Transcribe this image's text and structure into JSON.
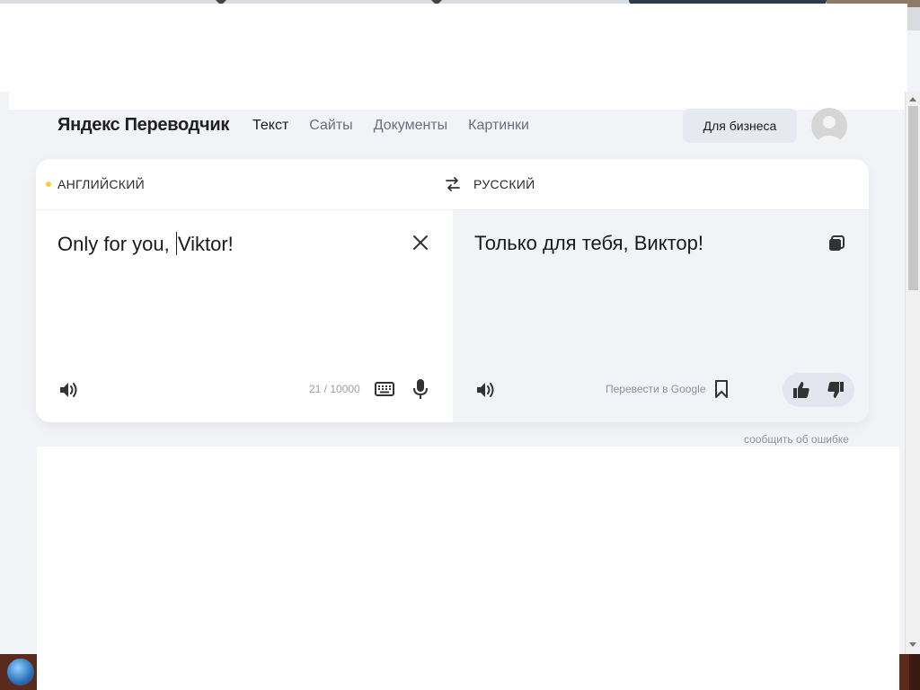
{
  "header": {
    "logo": "Яндекс Переводчик",
    "nav": [
      "Текст",
      "Сайты",
      "Документы",
      "Картинки"
    ],
    "business_button": "Для бизнеса"
  },
  "translator": {
    "source_language": "АНГЛИЙСКИЙ",
    "target_language": "РУССКИЙ",
    "source_text_before_caret": "Only for you, ",
    "source_text_after_caret": "Viktor!",
    "translated_text": "Только для тебя, Виктор!",
    "char_counter": "21 / 10000",
    "google_link": "Перевести в Google",
    "report_link": "сообщить об ошибке"
  },
  "colors": {
    "background": "#f2f3f7",
    "source_dot": "#ffcc33",
    "panel": "#ffffff"
  },
  "icons": {
    "swap": "swap-arrows-icon",
    "clear": "close-icon",
    "copy": "copy-icon",
    "speaker": "speaker-icon",
    "keyboard": "keyboard-icon",
    "microphone": "microphone-icon",
    "bookmark": "bookmark-icon",
    "share": "share-icon",
    "like": "thumbs-up-icon",
    "dislike": "thumbs-down-icon"
  }
}
